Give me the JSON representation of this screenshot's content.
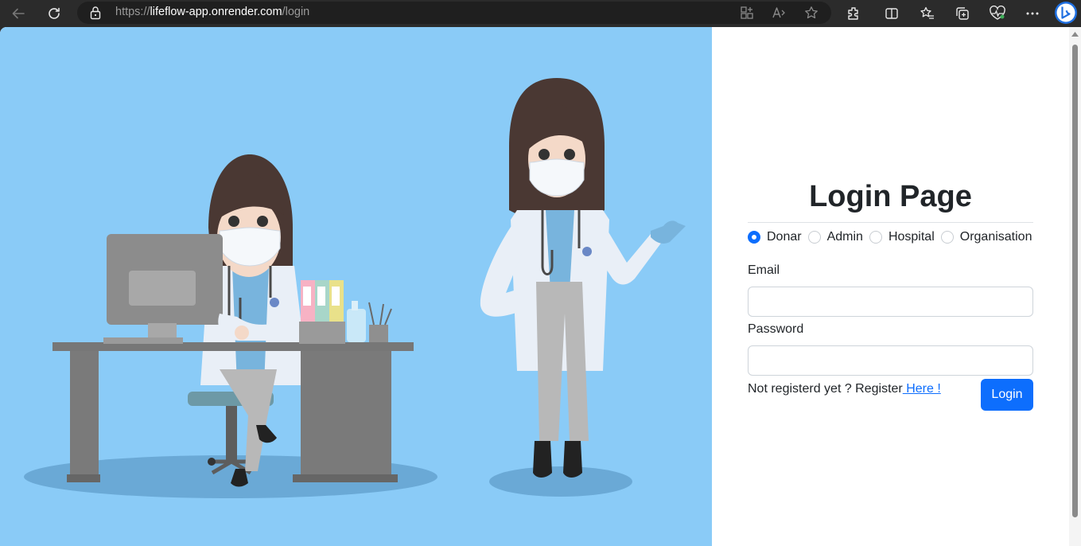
{
  "browser": {
    "url_scheme": "https://",
    "url_host": "lifeflow-app.onrender.com",
    "url_path": "/login",
    "icons": [
      "back-icon",
      "refresh-icon",
      "lock-icon",
      "app-available-icon",
      "read-aloud-icon",
      "favorite-star-icon",
      "extensions-icon",
      "split-screen-icon",
      "favorites-icon",
      "collections-icon",
      "browser-essentials-icon",
      "more-icon",
      "copilot-icon"
    ]
  },
  "hero": {
    "image": "doctors-illustration",
    "background": "#8acbf7"
  },
  "login": {
    "title": "Login Page",
    "roles": [
      {
        "label": "Donar",
        "checked": true
      },
      {
        "label": "Admin",
        "checked": false
      },
      {
        "label": "Hospital",
        "checked": false
      },
      {
        "label": "Organisation",
        "checked": false
      }
    ],
    "email_label": "Email",
    "email_value": "",
    "password_label": "Password",
    "password_value": "",
    "register_text": "Not registerd yet ? Register",
    "register_link": " Here !",
    "login_button": "Login"
  },
  "colors": {
    "primary": "#0d6efd",
    "toolbar": "#2b2b2b",
    "hero_bg": "#8acbf7"
  }
}
